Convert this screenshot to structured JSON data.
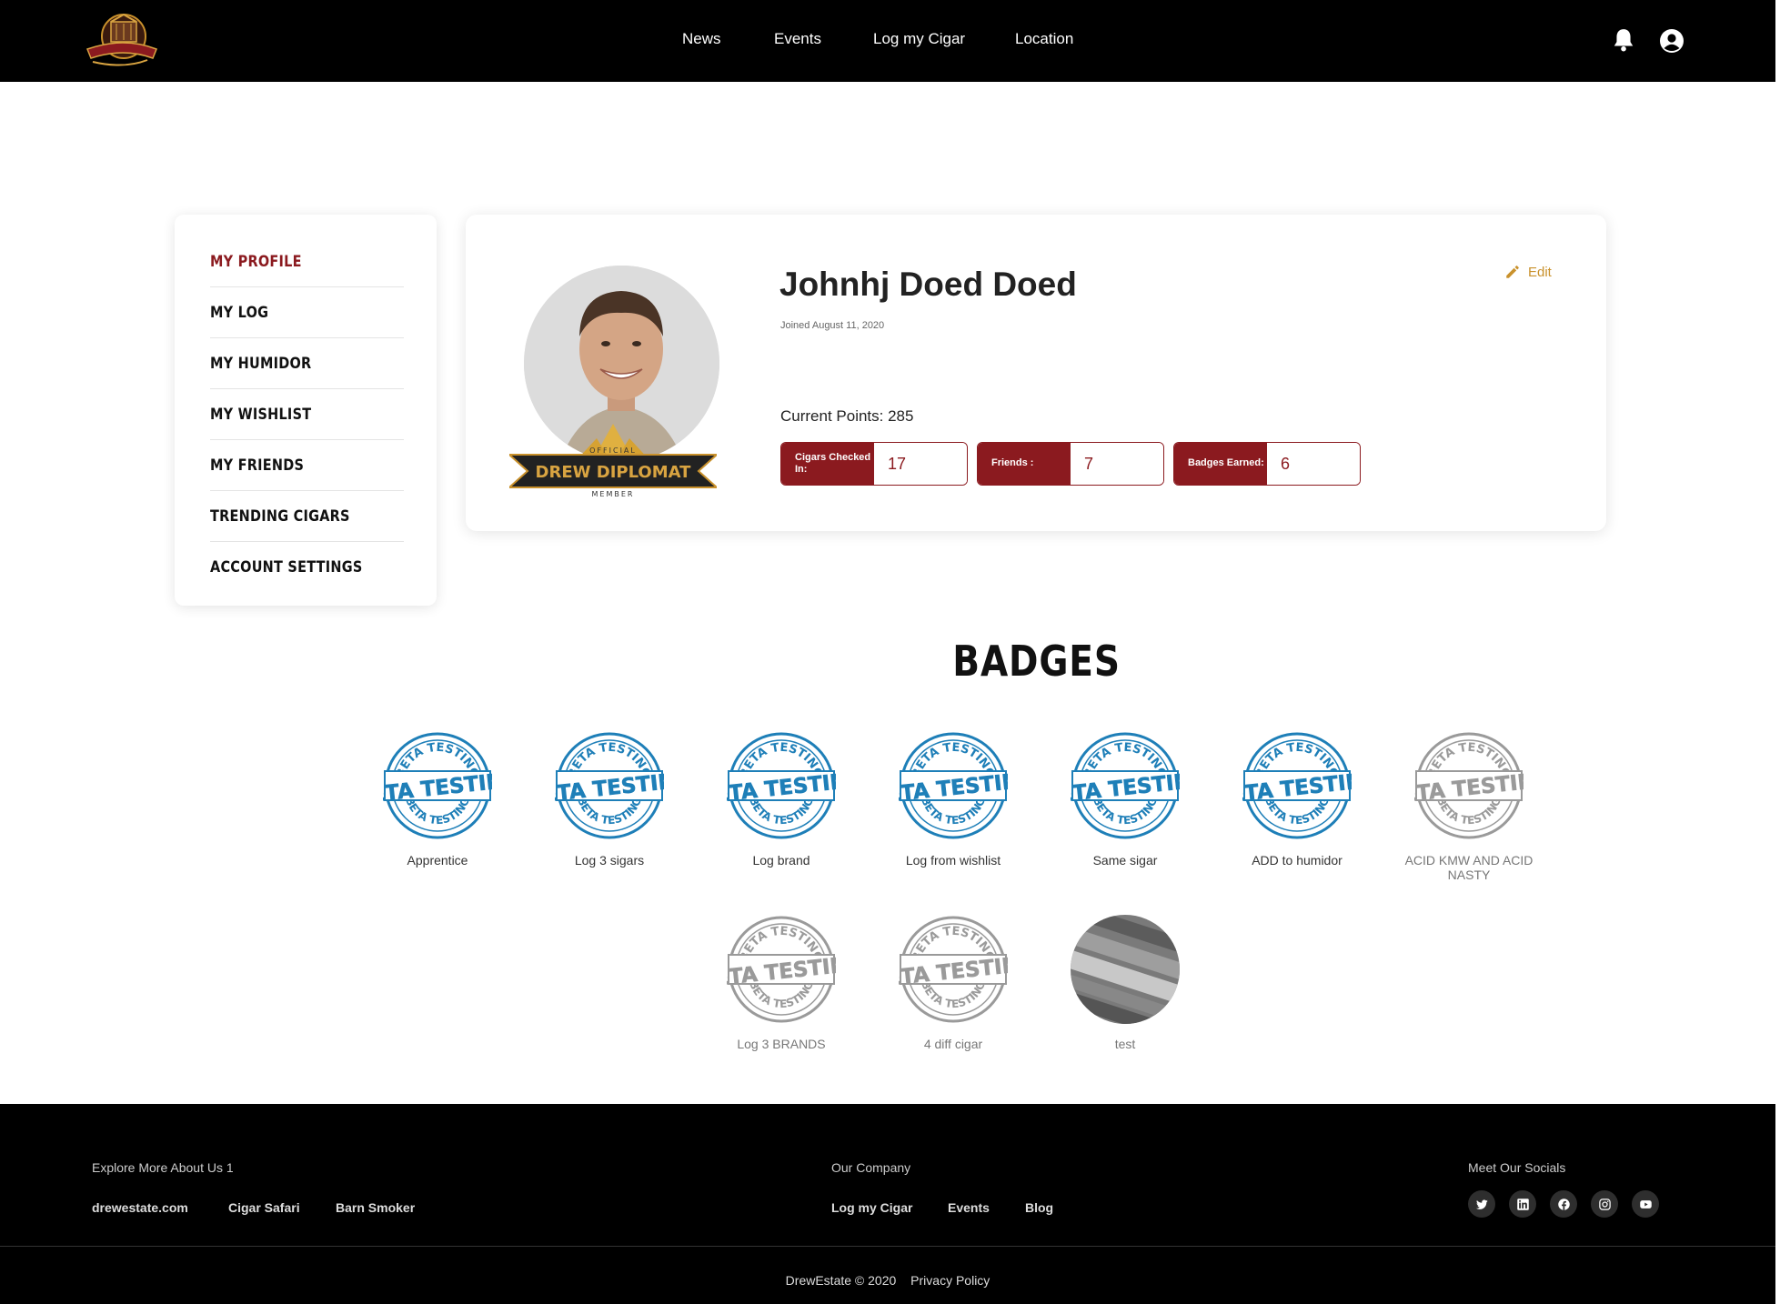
{
  "nav": {
    "logo_text": "DREW DIPLOMAT",
    "links": [
      "News",
      "Events",
      "Log my Cigar",
      "Location"
    ]
  },
  "sidebar": {
    "items": [
      "MY PROFILE",
      "MY LOG",
      "MY HUMIDOR",
      "MY WISHLIST",
      "MY FRIENDS",
      "TRENDING CIGARS",
      "ACCOUNT SETTINGS"
    ]
  },
  "profile": {
    "name": "Johnhj Doed Doed",
    "joined": "Joined August 11, 2020",
    "edit_label": "Edit",
    "points_label": "Current Points: 285",
    "member_badge_text": [
      "OFFICIAL",
      "DREW DIPLOMAT",
      "MEMBER"
    ],
    "stats": [
      {
        "label": "Cigars Checked In:",
        "value": "17"
      },
      {
        "label": "Friends :",
        "value": "7"
      },
      {
        "label": "Badges Earned:",
        "value": "6"
      }
    ]
  },
  "badges": {
    "title": "BADGES",
    "stamp_text": "BETA TESTING",
    "items": [
      {
        "label": "Apprentice",
        "earned": true
      },
      {
        "label": "Log 3 sigars",
        "earned": true
      },
      {
        "label": "Log brand",
        "earned": true
      },
      {
        "label": "Log from wishlist",
        "earned": true
      },
      {
        "label": "Same sigar",
        "earned": true
      },
      {
        "label": "ADD to humidor",
        "earned": true
      },
      {
        "label": "ACID KMW AND ACID NASTY",
        "earned": false
      },
      {
        "label": "Log 3 BRANDS",
        "earned": false
      },
      {
        "label": "4 diff cigar",
        "earned": false
      },
      {
        "label": "test",
        "earned": false
      }
    ]
  },
  "footer": {
    "explore": {
      "heading": "Explore More About Us 1",
      "links": [
        "drewestate.com",
        "Cigar Safari",
        "Barn Smoker"
      ]
    },
    "company": {
      "heading": "Our Company",
      "links": [
        "Log my Cigar",
        "Events",
        "Blog"
      ]
    },
    "socials": {
      "heading": "Meet Our Socials",
      "icons": [
        "twitter-icon",
        "linkedin-icon",
        "facebook-icon",
        "instagram-icon",
        "youtube-icon"
      ]
    },
    "copyright": "DrewEstate © 2020",
    "privacy": "Privacy Policy"
  },
  "colors": {
    "accent": "#8b1a1f",
    "edit": "#c9912c",
    "badge_blue": "#1e7fb8",
    "badge_gray": "#9a9a9a",
    "topbar": "#000000"
  }
}
